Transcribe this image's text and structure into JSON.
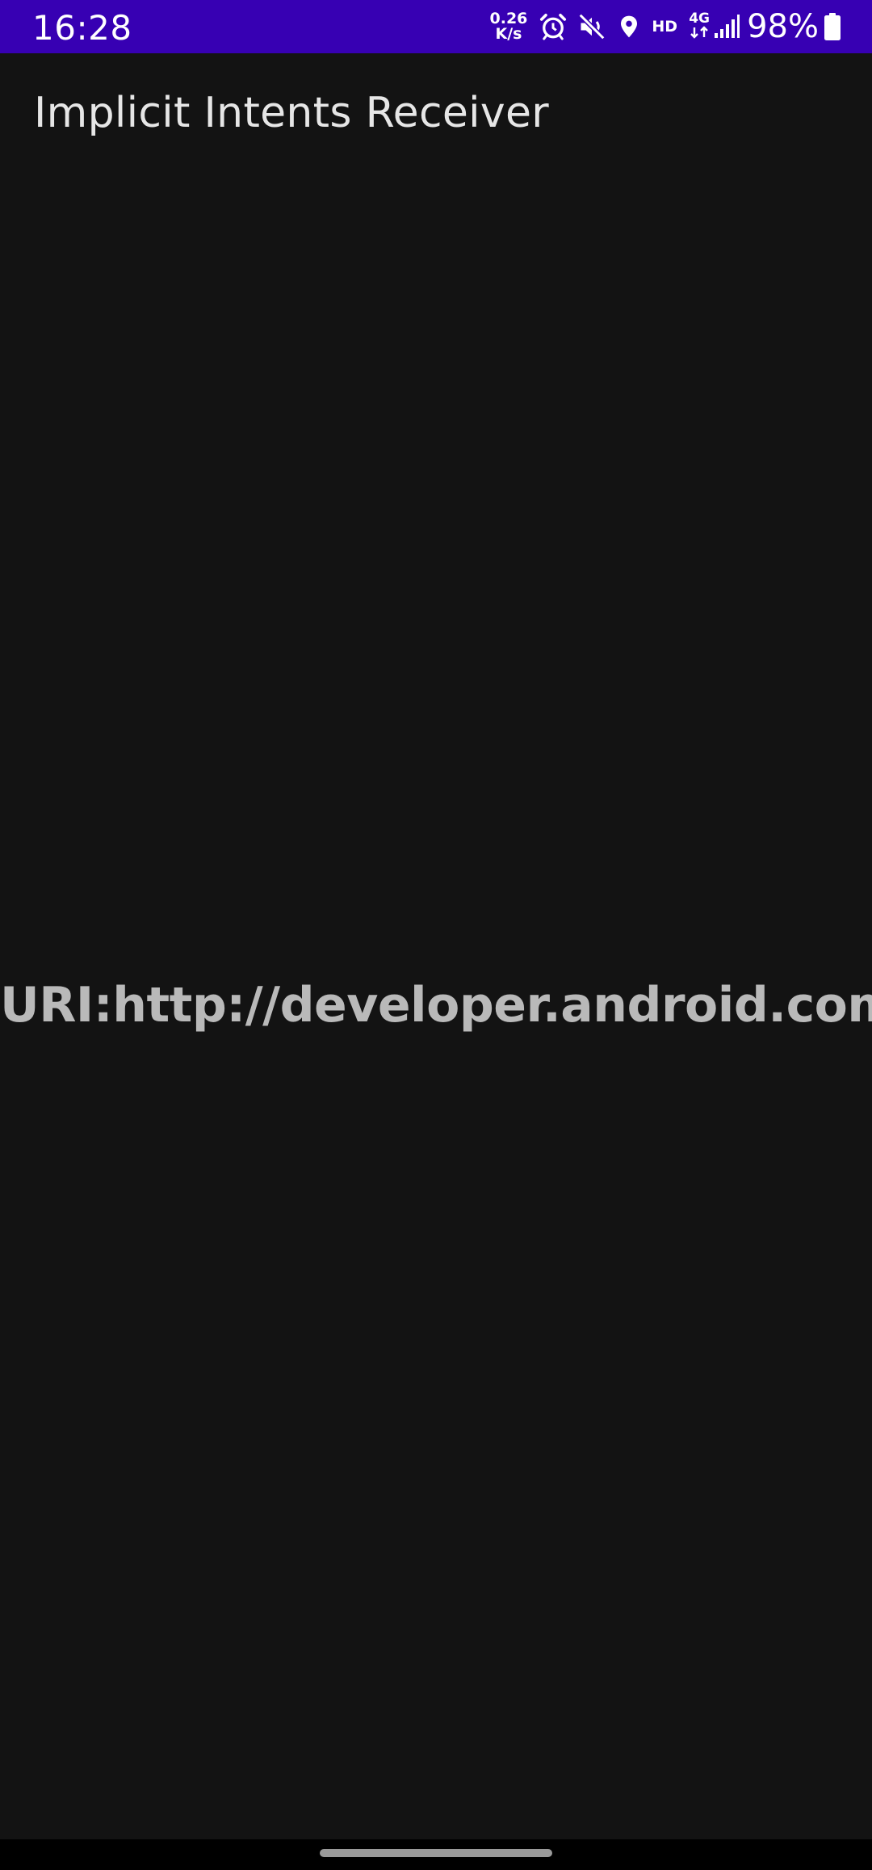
{
  "status_bar": {
    "time": "16:28",
    "net_speed_value": "0.26",
    "net_speed_unit": "K/s",
    "icons": [
      "alarm-icon",
      "mute-icon",
      "location-icon"
    ],
    "hd_label": "HD",
    "network_label": "4G",
    "battery_percent": "98%",
    "background_color": "#3700B3"
  },
  "app_bar": {
    "title": "Implicit Intents Receiver"
  },
  "content": {
    "uri_text": "URI:http://developer.android.com"
  }
}
